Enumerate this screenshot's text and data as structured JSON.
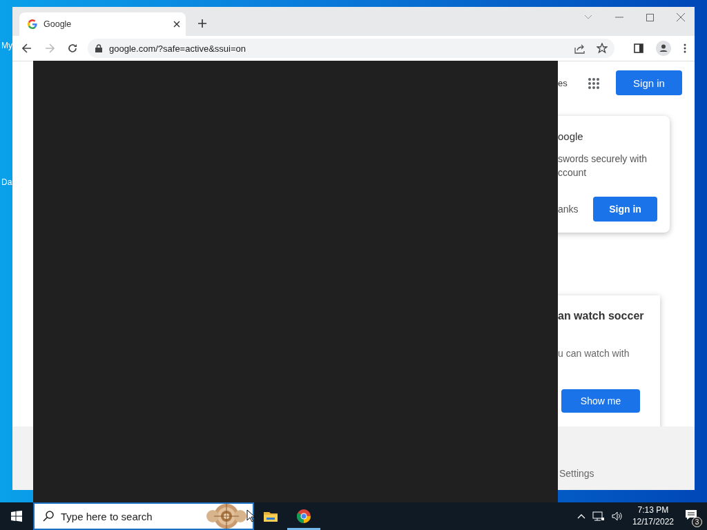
{
  "desktop": {
    "icon_labels": [
      "My",
      "Da"
    ]
  },
  "browser": {
    "tabs": [
      {
        "title": "Google",
        "selected": true
      }
    ],
    "address": "google.com/?safe=active&ssui=on",
    "page": {
      "header_link": "es",
      "sign_in": "Sign in",
      "sign_in_card": {
        "title": "oogle",
        "lines": [
          "swords securely with",
          "ccount"
        ],
        "dismiss": "anks",
        "button": "Sign in"
      },
      "promo_card": {
        "title": "an watch soccer",
        "text": "u can watch with",
        "button": "Show me"
      },
      "footer_link": "Settings"
    }
  },
  "taskbar": {
    "search_placeholder": "Type here to search",
    "apps": [
      {
        "kind": "explorer",
        "active": false
      },
      {
        "kind": "chrome",
        "active": true
      }
    ],
    "time": "7:13 PM",
    "date": "12/17/2022",
    "notification_count": "3"
  }
}
